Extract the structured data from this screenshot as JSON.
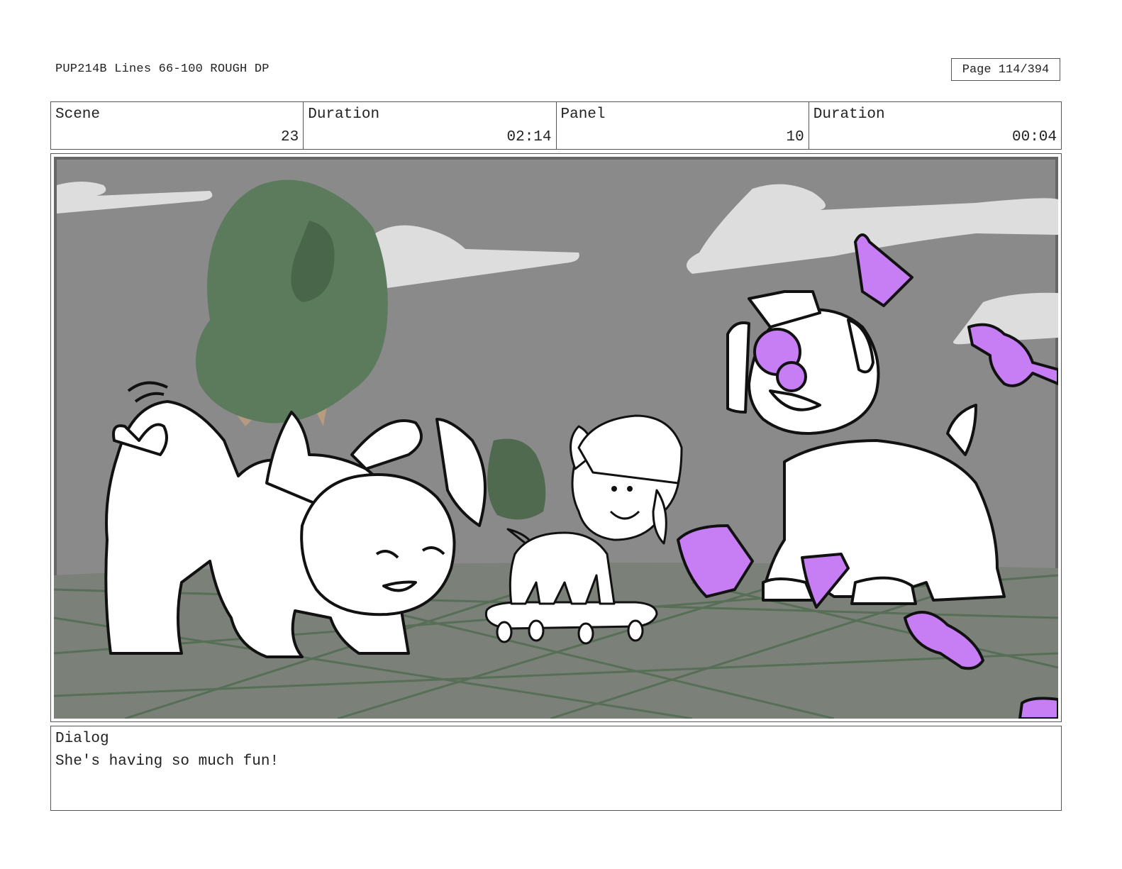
{
  "header": {
    "title": "PUP214B Lines 66-100 ROUGH DP",
    "page": "Page 114/394"
  },
  "info": {
    "scene_label": "Scene",
    "scene_value": "23",
    "duration_label": "Duration",
    "duration_value": "02:14",
    "panel_label": "Panel",
    "panel_value": "10",
    "panel_duration_label": "Duration",
    "panel_duration_value": "00:04"
  },
  "dialog": {
    "label": "Dialog",
    "text": "She's having so much fun!"
  },
  "colors": {
    "sky": "#8a8a8a",
    "cloud": "#dddddd",
    "ground": "#7b8079",
    "grid": "#4f6a4f",
    "tree": "#5c7a5c",
    "candy": "#c77ef5"
  }
}
